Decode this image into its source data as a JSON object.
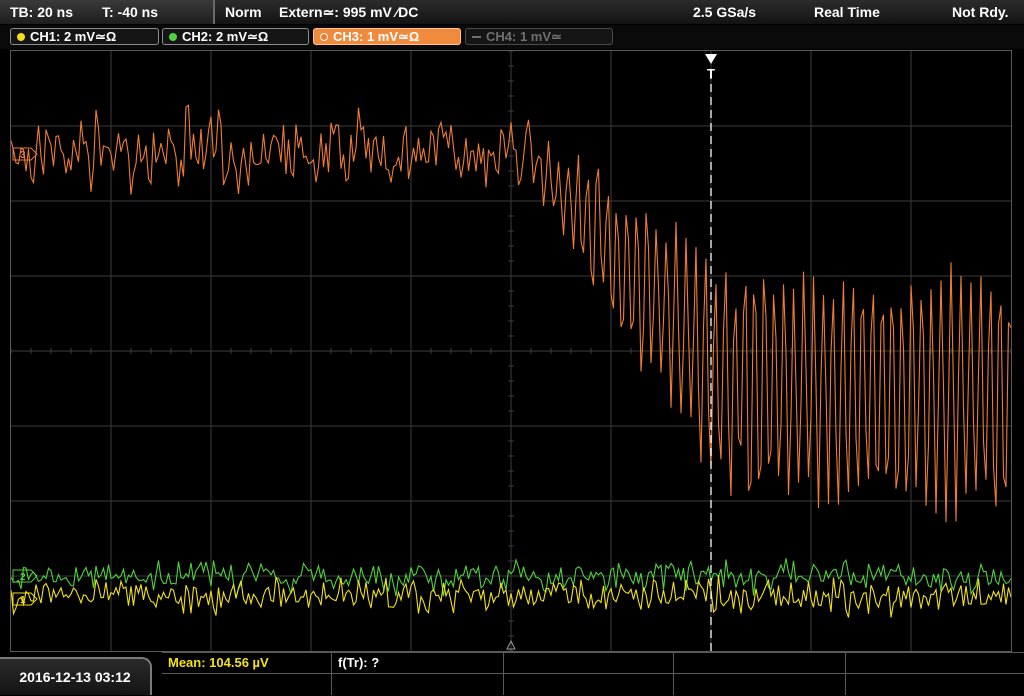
{
  "status": {
    "timebase": "TB: 20 ns",
    "trigger_time": "T: -40 ns",
    "acq_mode": "Norm",
    "trigger_source": "Extern≃: 995 mV ∕DC",
    "sample_rate": "2.5 GSa/s",
    "mode": "Real Time",
    "state": "Not Rdy."
  },
  "channels": [
    {
      "label": "CH1: 2 mV≃Ω",
      "color": "#f2e11a",
      "active": false,
      "enabled": true
    },
    {
      "label": "CH2: 2 mV≃Ω",
      "color": "#4fd23c",
      "active": false,
      "enabled": true
    },
    {
      "label": "CH3: 1 mV≃Ω",
      "color": "#f07c33",
      "active": true,
      "enabled": true
    },
    {
      "label": "CH4: 1 mV≃",
      "color": "#6f6f6f",
      "active": false,
      "enabled": false
    }
  ],
  "markers": {
    "ch3_ground": "3",
    "ch2_ground": "2",
    "ch1_ground": "1",
    "trigger_label": "T"
  },
  "measurements": {
    "mean": "Mean: 104.56 µV",
    "rise_freq": "f(Tr): ?"
  },
  "datetime": "2016-12-13 03:12",
  "colors": {
    "ch1": "#f2e11a",
    "ch2": "#4fd23c",
    "ch3": "#f07c33",
    "grid": "#3c3c3c",
    "mean_text": "#f2e11a"
  }
}
